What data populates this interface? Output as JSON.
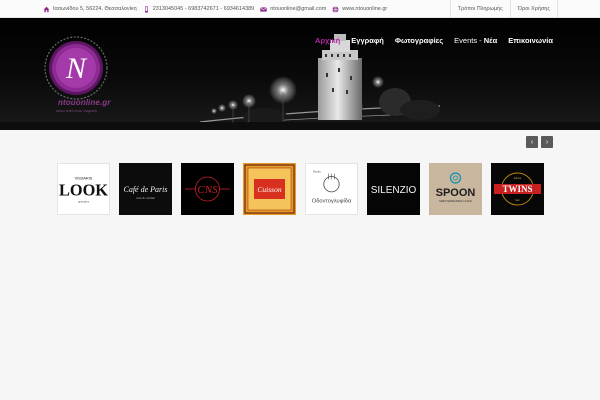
{
  "topbar": {
    "address": "Ιασωνίδου 5, 56224, Θεσσαλονίκη",
    "phones": "2313045045 - 6983742671 - 6934614389",
    "email": "ntouonline@gmail.com",
    "website": "www.ntouonline.gr",
    "links": [
      {
        "label": "Τρόποι Πληρωμής"
      },
      {
        "label": "Όροι Χρήσης"
      }
    ]
  },
  "brand": {
    "logo_letter": "N",
    "name": "ntouonline.gr",
    "tagline": "κάτω από έναν ουρανό",
    "accent_color": "#b0289e"
  },
  "nav": {
    "items": [
      {
        "label": "Αρχική",
        "active": true
      },
      {
        "label": "Εγγραφή"
      },
      {
        "label": "Φωτογραφίες"
      },
      {
        "label_a": "Events -",
        "label_b": "Νέα"
      },
      {
        "label": "Επικοινωνία"
      }
    ]
  },
  "slider": {
    "prev_icon": "‹",
    "next_icon": "›"
  },
  "partners": [
    {
      "top": "VISSARIS",
      "name": "LOOK",
      "sub": "opticians"
    },
    {
      "name": "Café de Paris",
      "sub": "wine & cocktail"
    },
    {
      "name": "CNS"
    },
    {
      "name": "Cuisson"
    },
    {
      "top": "Studio",
      "name": "Οδοντογλυφίδα"
    },
    {
      "name": "SILENZIO"
    },
    {
      "name": "SPOON",
      "sub": "MEDITERRANEAN CAFE"
    },
    {
      "top": "Since",
      "name": "TWINS",
      "sub": "bar"
    }
  ]
}
